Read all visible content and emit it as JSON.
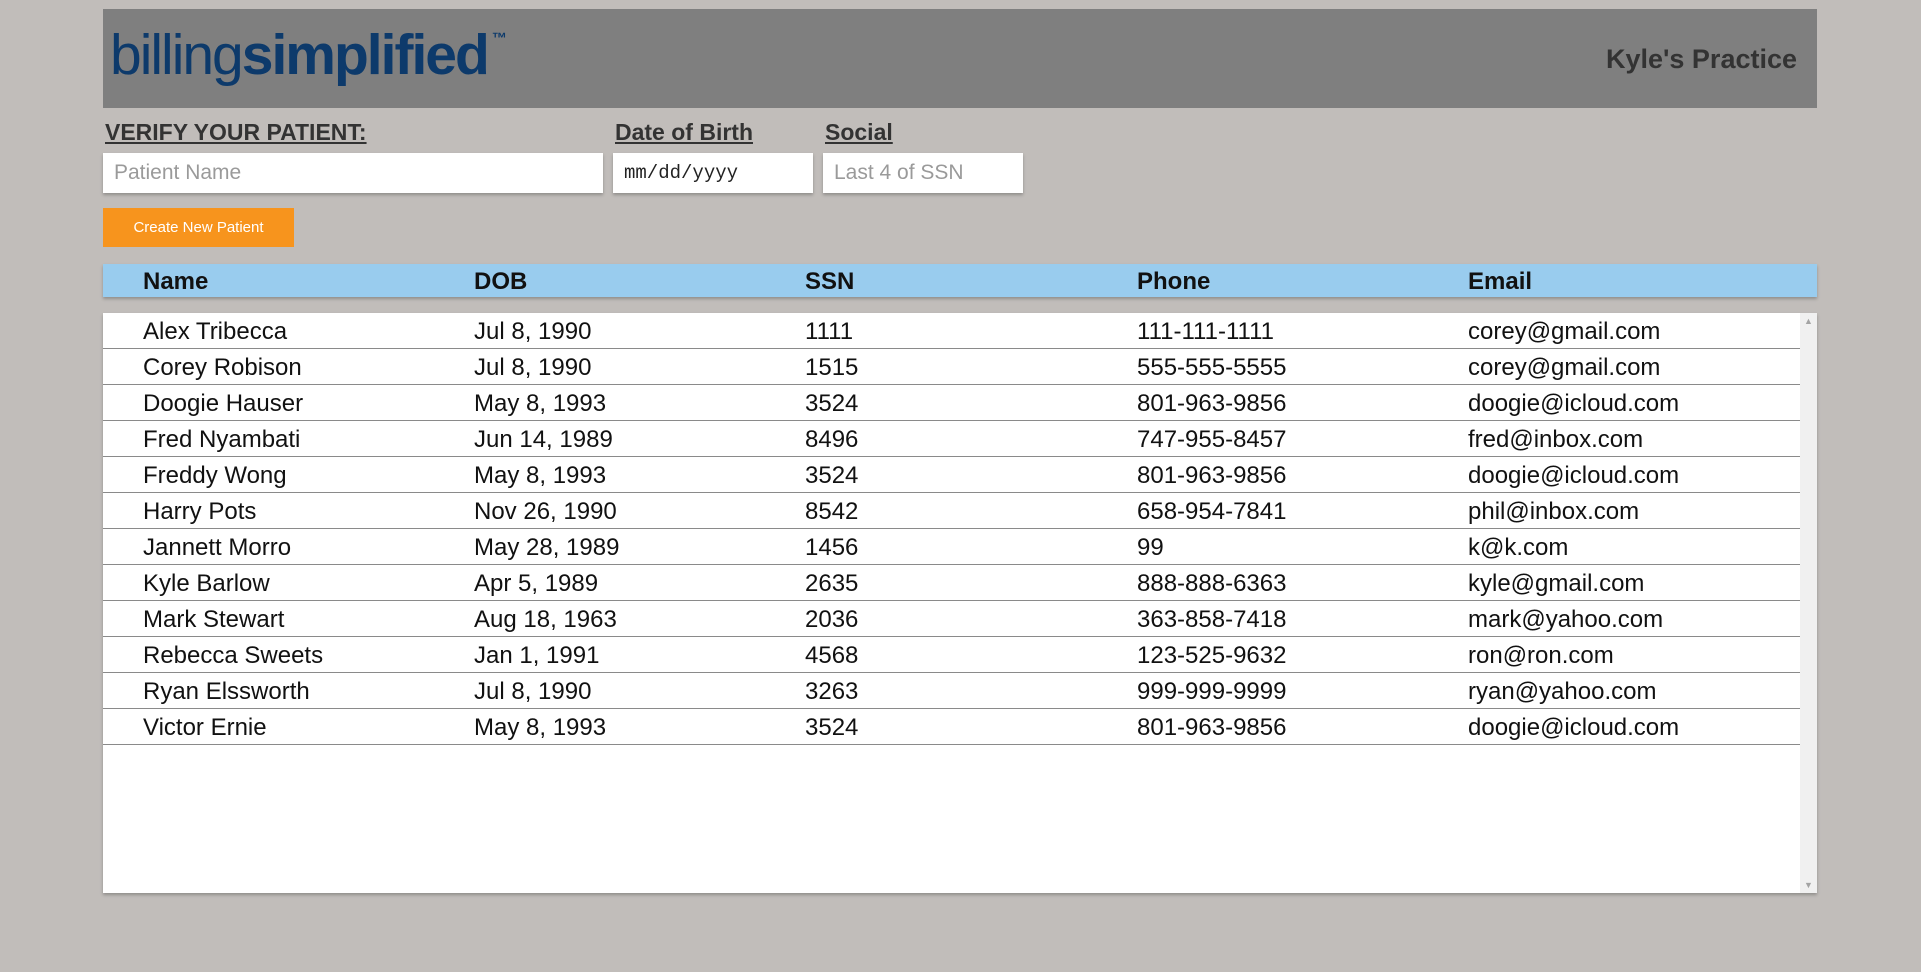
{
  "header": {
    "logo_light": "billing",
    "logo_bold": "simplified",
    "logo_tm": "™",
    "practice_name": "Kyle's Practice"
  },
  "verify": {
    "title": "VERIFY YOUR PATIENT:",
    "name_placeholder": "Patient Name",
    "dob_label": "Date of Birth",
    "dob_placeholder": "mm/dd/yyyy",
    "social_label": "Social",
    "social_placeholder": "Last 4 of SSN"
  },
  "actions": {
    "create_label": "Create New Patient"
  },
  "table": {
    "columns": [
      "Name",
      "DOB",
      "SSN",
      "Phone",
      "Email"
    ],
    "rows": [
      {
        "name": "Alex Tribecca",
        "dob": "Jul 8, 1990",
        "ssn": "1111",
        "phone": "111-111-1111",
        "email": "corey@gmail.com"
      },
      {
        "name": "Corey Robison",
        "dob": "Jul 8, 1990",
        "ssn": "1515",
        "phone": "555-555-5555",
        "email": "corey@gmail.com"
      },
      {
        "name": "Doogie Hauser",
        "dob": "May 8, 1993",
        "ssn": "3524",
        "phone": "801-963-9856",
        "email": "doogie@icloud.com"
      },
      {
        "name": "Fred Nyambati",
        "dob": "Jun 14, 1989",
        "ssn": "8496",
        "phone": "747-955-8457",
        "email": "fred@inbox.com"
      },
      {
        "name": "Freddy Wong",
        "dob": "May 8, 1993",
        "ssn": "3524",
        "phone": "801-963-9856",
        "email": "doogie@icloud.com"
      },
      {
        "name": "Harry Pots",
        "dob": "Nov 26, 1990",
        "ssn": "8542",
        "phone": "658-954-7841",
        "email": "phil@inbox.com"
      },
      {
        "name": "Jannett Morro",
        "dob": "May 28, 1989",
        "ssn": "1456",
        "phone": "99",
        "email": "k@k.com"
      },
      {
        "name": "Kyle Barlow",
        "dob": "Apr 5, 1989",
        "ssn": "2635",
        "phone": "888-888-6363",
        "email": "kyle@gmail.com"
      },
      {
        "name": "Mark Stewart",
        "dob": "Aug 18, 1963",
        "ssn": "2036",
        "phone": "363-858-7418",
        "email": "mark@yahoo.com"
      },
      {
        "name": "Rebecca Sweets",
        "dob": "Jan 1, 1991",
        "ssn": "4568",
        "phone": "123-525-9632",
        "email": "ron@ron.com"
      },
      {
        "name": "Ryan Elssworth",
        "dob": "Jul 8, 1990",
        "ssn": "3263",
        "phone": "999-999-9999",
        "email": "ryan@yahoo.com"
      },
      {
        "name": "Victor Ernie",
        "dob": "May 8, 1993",
        "ssn": "3524",
        "phone": "801-963-9856",
        "email": "doogie@icloud.com"
      }
    ]
  },
  "colors": {
    "page_bg": "#c1bdba",
    "header_bg": "#7f7f7f",
    "logo": "#0d3a6b",
    "accent_button": "#f7941d",
    "table_header_bg": "#99ccee"
  }
}
